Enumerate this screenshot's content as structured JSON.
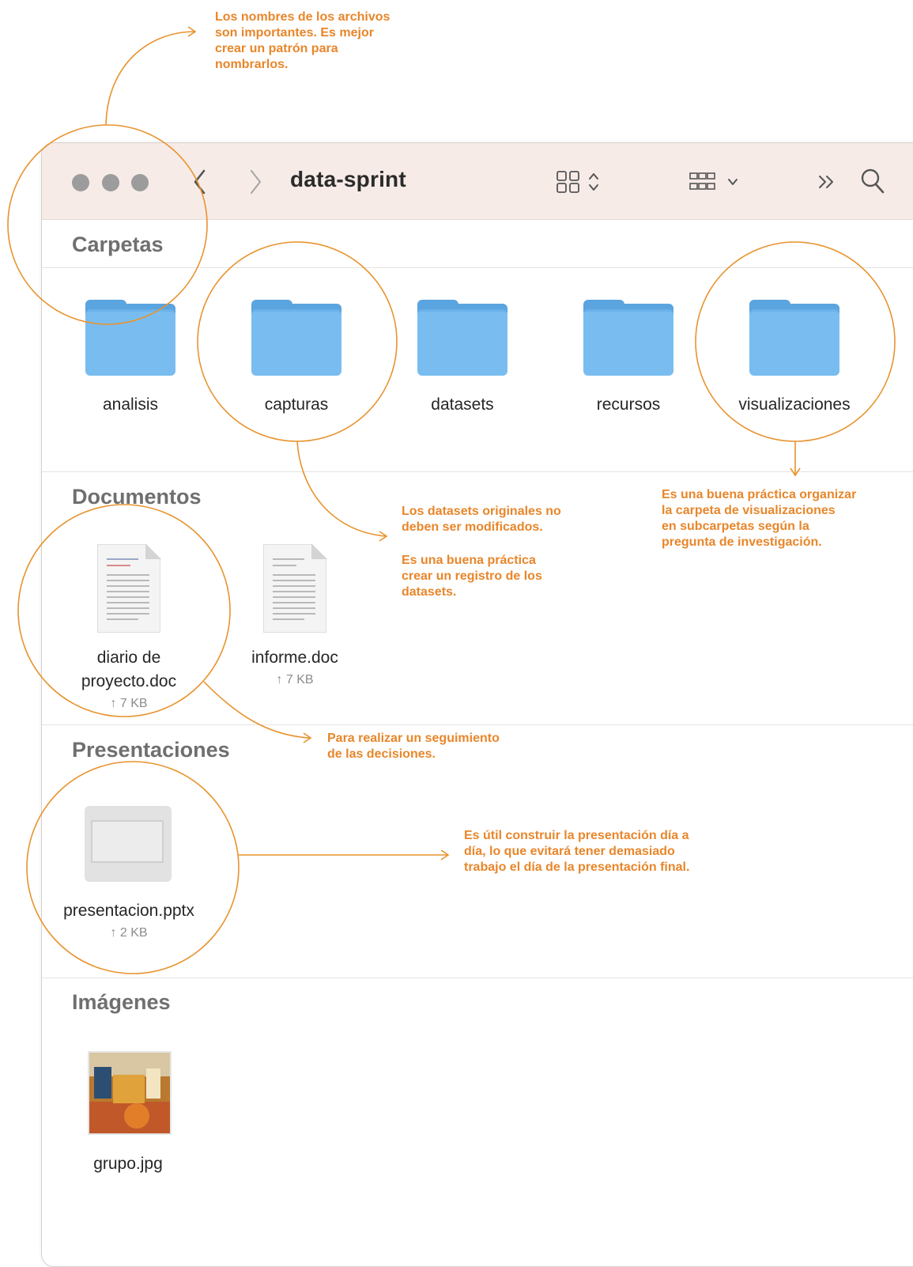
{
  "window": {
    "title": "data-sprint"
  },
  "toolbar": {
    "icons": [
      "traffic-lights",
      "back-chevron-icon",
      "forward-chevron-icon",
      "icon-view-grid-icon",
      "sort-chevrons-icon",
      "group-grid-icon",
      "chevron-down-icon",
      "more-chevrons-icon",
      "search-icon"
    ]
  },
  "sections": {
    "folders": {
      "header": "Carpetas",
      "items": [
        "analisis",
        "capturas",
        "datasets",
        "recursos",
        "visualizaciones"
      ]
    },
    "documents": {
      "header": "Documentos",
      "items": [
        {
          "name": "diario de\nproyecto.doc",
          "size": "↑ 7 KB"
        },
        {
          "name": "informe.doc",
          "size": "↑ 7 KB"
        }
      ]
    },
    "presentations": {
      "header": "Presentaciones",
      "items": [
        {
          "name": "presentacion.pptx",
          "size": "↑ 2 KB"
        }
      ]
    },
    "images": {
      "header": "Imágenes",
      "items": [
        {
          "name": "grupo.jpg"
        }
      ]
    }
  },
  "annotations": {
    "file_names": "Los nombres de los archivos\nson importantes. Es mejor\ncrear un patrón para\nnombrarlos.",
    "datasets_original": "Los datasets originales no\ndeben ser modificados.",
    "datasets_registry": "Es una buena práctica\ncrear un registro de los\ndatasets.",
    "visualizations": "Es una buena práctica organizar\nla carpeta de visualizaciones\nen subcarpetas según la\npregunta de investigación.",
    "diary": "Para realizar un seguimiento\nde las decisiones.",
    "presentation": "Es útil construir la presentación día a\ndía, lo que evitará tener demasiado\ntrabajo el día de la presentación final."
  },
  "colors": {
    "annotation": "#e8862a",
    "folder": "#79bdf0",
    "toolbar": "#f7ebe8"
  }
}
